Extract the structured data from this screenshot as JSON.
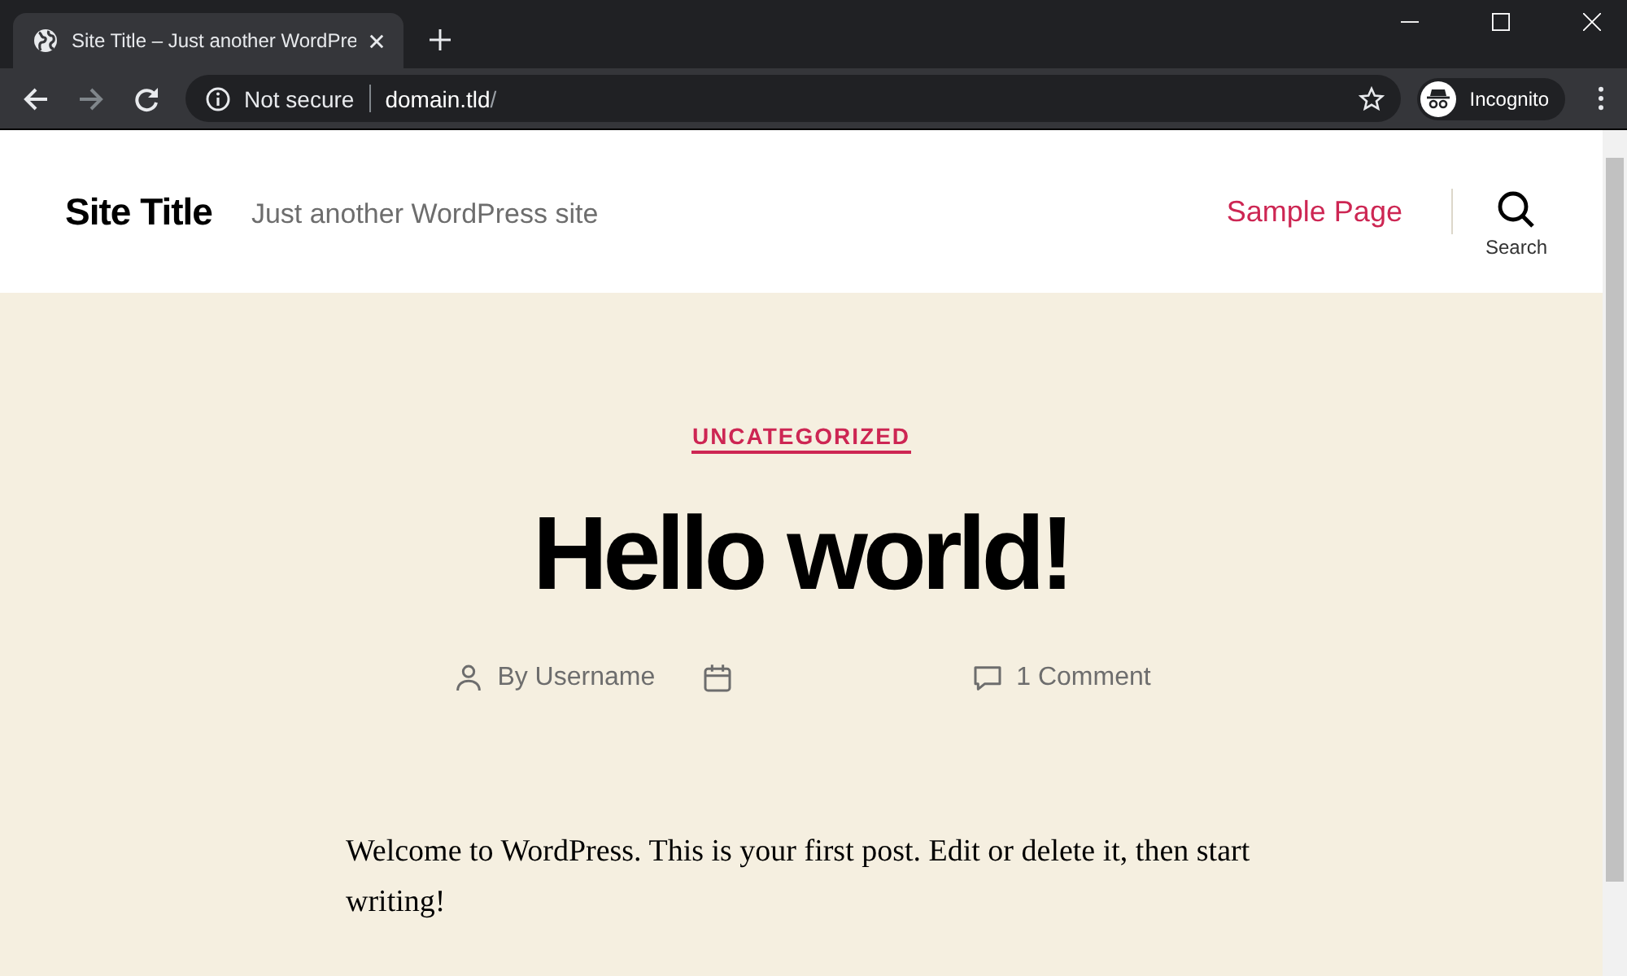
{
  "browser": {
    "tab": {
      "title": "Site Title – Just another WordPre",
      "selected": true
    },
    "toolbar": {
      "security": "Not secure",
      "url_host": "domain.tld",
      "url_path": "/",
      "profile": "Incognito"
    }
  },
  "header": {
    "site_title": "Site Title",
    "tagline": "Just another WordPress site",
    "menu": [
      {
        "label": "Sample Page"
      }
    ],
    "search_label": "Search"
  },
  "post": {
    "category": "UNCATEGORIZED",
    "title": "Hello world!",
    "meta": [
      {
        "kind": "author",
        "text": "By Username"
      },
      {
        "kind": "date"
      },
      {
        "kind": "comments",
        "text": "1 Comment"
      }
    ],
    "body": "Welcome to WordPress. This is your first post. Edit or delete it, then start writing!"
  }
}
